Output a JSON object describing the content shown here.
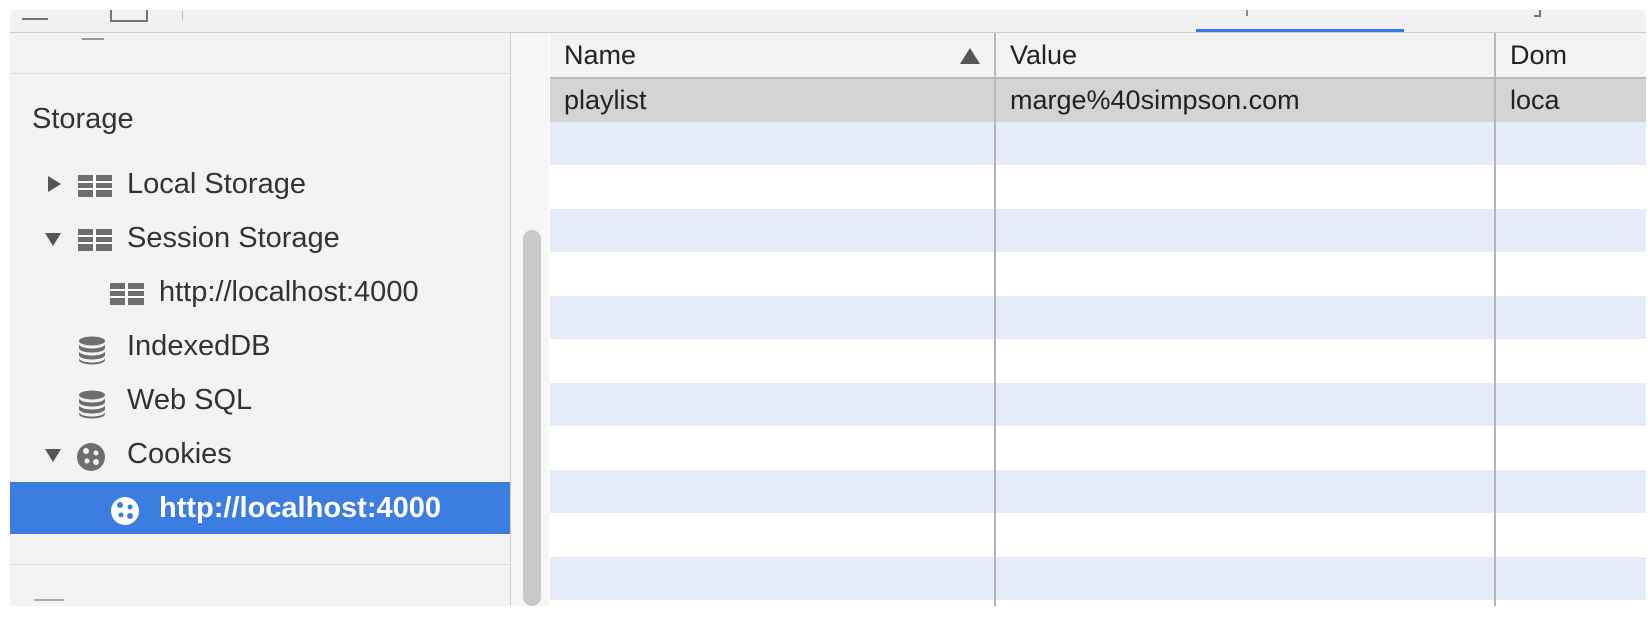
{
  "sidebar": {
    "section_title": "Storage",
    "items": [
      {
        "label": "Local Storage",
        "expand": "collapsed",
        "icon": "grid-icon"
      },
      {
        "label": "Session Storage",
        "expand": "expanded",
        "icon": "grid-icon"
      },
      {
        "label": "http://localhost:4000",
        "expand": "none",
        "icon": "grid-icon"
      },
      {
        "label": "IndexedDB",
        "expand": "none",
        "icon": "database-icon"
      },
      {
        "label": "Web SQL",
        "expand": "none",
        "icon": "database-icon"
      },
      {
        "label": "Cookies",
        "expand": "expanded",
        "icon": "cookie-icon"
      },
      {
        "label": "http://localhost:4000",
        "expand": "none",
        "icon": "cookie-icon",
        "selected": true
      }
    ]
  },
  "table": {
    "columns": [
      {
        "label": "Name",
        "sort": "ascending"
      },
      {
        "label": "Value"
      },
      {
        "label": "Dom"
      }
    ],
    "rows": [
      {
        "name": "playlist",
        "value": "marge%40simpson.com",
        "domain": "loca"
      }
    ]
  },
  "colors": {
    "selection": "#3b7de0",
    "row_alt": "#e5ebf8",
    "row_selected": "#d4d4d4",
    "sidebar_bg": "#f3f3f3",
    "active_tab_underline": "#3b78e7"
  }
}
